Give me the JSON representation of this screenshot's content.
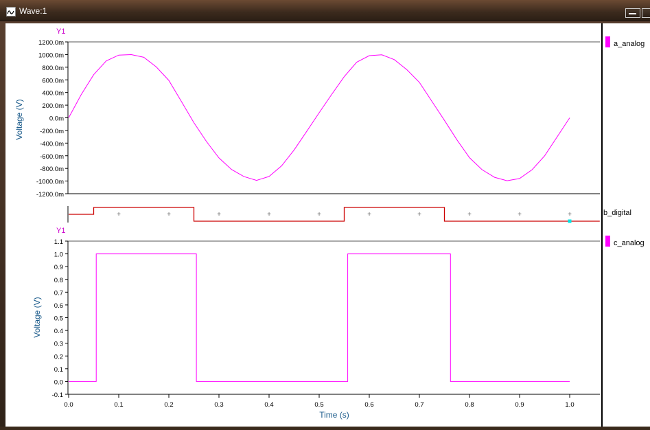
{
  "window": {
    "title": "Wave:1"
  },
  "colors": {
    "analog": "#ff00ff",
    "digital": "#cc0000",
    "axis": "#000000",
    "label": "#1a5a8a",
    "ytag": "#cc00cc",
    "marker": "#00e5e5"
  },
  "chart_data": [
    {
      "type": "line",
      "name_tag": "Y1",
      "ylabel": "Voltage (V)",
      "ylim": [
        -1200,
        1200
      ],
      "yticks": [
        "1200.0m",
        "1000.0m",
        "800.0m",
        "600.0m",
        "400.0m",
        "200.0m",
        "0.0m",
        "-200.0m",
        "-400.0m",
        "-600.0m",
        "-800.0m",
        "-1000.0m",
        "-1200.0m"
      ],
      "ytick_values": [
        1200,
        1000,
        800,
        600,
        400,
        200,
        0,
        -200,
        -400,
        -600,
        -800,
        -1000,
        -1200
      ],
      "legend": "a_analog",
      "series": [
        {
          "name": "a_analog",
          "x": [
            0,
            0.025,
            0.05,
            0.075,
            0.1,
            0.125,
            0.15,
            0.175,
            0.2,
            0.225,
            0.25,
            0.275,
            0.3,
            0.325,
            0.35,
            0.375,
            0.4,
            0.425,
            0.45,
            0.475,
            0.5,
            0.525,
            0.55,
            0.575,
            0.6,
            0.625,
            0.65,
            0.675,
            0.7,
            0.725,
            0.75,
            0.775,
            0.8,
            0.825,
            0.85,
            0.875,
            0.9,
            0.925,
            0.95,
            0.975,
            1.0
          ],
          "y": [
            0,
            367,
            682,
            899,
            991,
            999,
            957,
            804,
            591,
            259,
            -77,
            -375,
            -634,
            -817,
            -930,
            -989,
            -927,
            -759,
            -508,
            -215,
            80,
            370,
            650,
            880,
            983,
            996,
            920,
            760,
            560,
            260,
            -40,
            -350,
            -630,
            -820,
            -940,
            -995,
            -960,
            -820,
            -600,
            -300,
            0
          ]
        }
      ]
    },
    {
      "type": "line",
      "legend": "b_digital",
      "series": [
        {
          "name": "b_digital",
          "x": [
            0,
            0.05,
            0.05,
            0.25,
            0.25,
            0.55,
            0.55,
            0.75,
            0.75,
            1.06
          ],
          "y": [
            0.5,
            0.5,
            1,
            1,
            0,
            0,
            1,
            1,
            0,
            0
          ]
        }
      ],
      "marker_x": 1.0
    },
    {
      "type": "line",
      "name_tag": "Y1",
      "ylabel": "Voltage (V)",
      "xlabel": "Time (s)",
      "ylim": [
        -0.1,
        1.1
      ],
      "yticks": [
        "1.1",
        "1.0",
        "0.9",
        "0.8",
        "0.7",
        "0.6",
        "0.5",
        "0.4",
        "0.3",
        "0.2",
        "0.1",
        "0.0",
        "-0.1"
      ],
      "ytick_values": [
        1.1,
        1.0,
        0.9,
        0.8,
        0.7,
        0.6,
        0.5,
        0.4,
        0.3,
        0.2,
        0.1,
        0.0,
        -0.1
      ],
      "xticks": [
        "0.0",
        "0.1",
        "0.2",
        "0.3",
        "0.4",
        "0.5",
        "0.6",
        "0.7",
        "0.8",
        "0.9",
        "1.0"
      ],
      "xtick_values": [
        0,
        0.1,
        0.2,
        0.3,
        0.4,
        0.5,
        0.6,
        0.7,
        0.8,
        0.9,
        1.0
      ],
      "xlim": [
        0,
        1.06
      ],
      "legend": "c_analog",
      "series": [
        {
          "name": "c_analog",
          "x": [
            0,
            0.055,
            0.055,
            0.255,
            0.255,
            0.557,
            0.557,
            0.762,
            0.762,
            1.0
          ],
          "y": [
            0,
            0,
            1,
            1,
            0,
            0,
            1,
            1,
            0,
            0
          ]
        }
      ]
    }
  ]
}
